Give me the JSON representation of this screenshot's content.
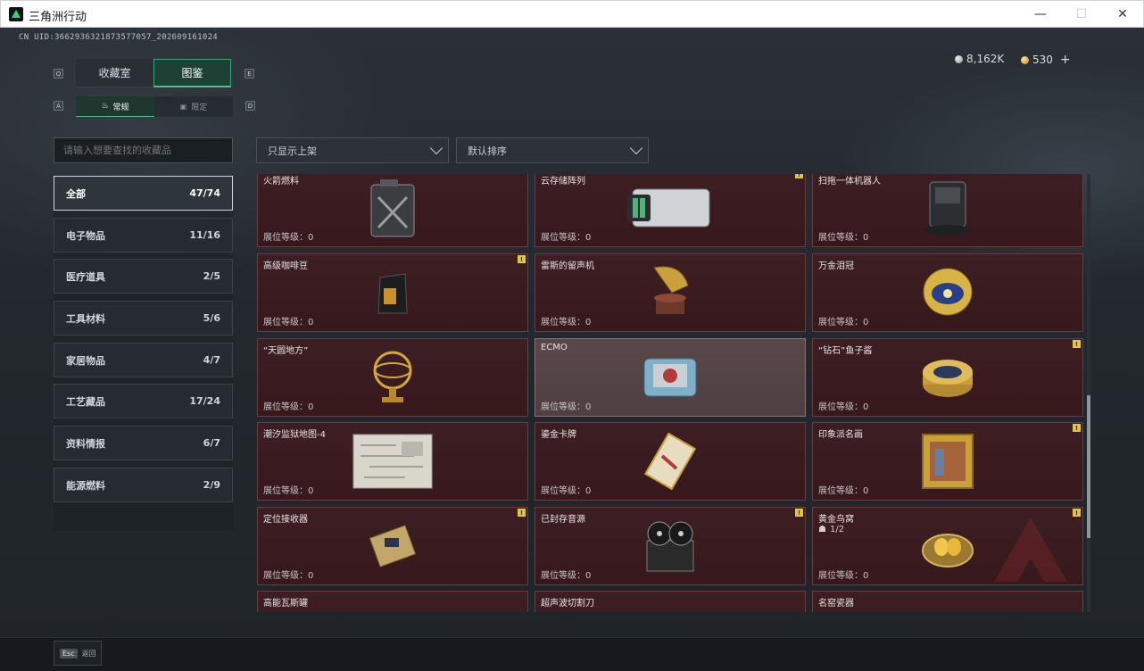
{
  "window": {
    "title": "三角洲行动",
    "min": "—",
    "max": "☐",
    "close": "✕"
  },
  "uid": "CN UID:3662936321873577057_202609161024",
  "currency": {
    "silver": "8,162K",
    "gold": "530",
    "add": "+"
  },
  "keys": {
    "q": "Q",
    "e": "E",
    "a": "A",
    "d": "D"
  },
  "tabs": [
    {
      "label": "收藏室"
    },
    {
      "label": "图鉴"
    }
  ],
  "subtabs": [
    {
      "label": "常规"
    },
    {
      "label": "限定"
    }
  ],
  "search": {
    "placeholder": "请输入想要查找的收藏品"
  },
  "filters": {
    "shelf": "只显示上架",
    "sort": "默认排序"
  },
  "categories": [
    {
      "label": "全部",
      "count": "47/74"
    },
    {
      "label": "电子物品",
      "count": "11/16"
    },
    {
      "label": "医疗道具",
      "count": "2/5"
    },
    {
      "label": "工具材料",
      "count": "5/6"
    },
    {
      "label": "家居物品",
      "count": "4/7"
    },
    {
      "label": "工艺藏品",
      "count": "17/24"
    },
    {
      "label": "资料情报",
      "count": "6/7"
    },
    {
      "label": "能源燃料",
      "count": "2/9"
    }
  ],
  "items": [
    {
      "name": "火箭燃料",
      "level": "展位等级：0",
      "badge": ""
    },
    {
      "name": "云存储阵列",
      "level": "展位等级：0",
      "badge": "!"
    },
    {
      "name": "扫拖一体机器人",
      "level": "展位等级：0",
      "badge": ""
    },
    {
      "name": "高级咖啡豆",
      "level": "展位等级：0",
      "badge": "!"
    },
    {
      "name": "雷斯的留声机",
      "level": "展位等级：0",
      "badge": ""
    },
    {
      "name": "万金泪冠",
      "level": "展位等级：0",
      "badge": ""
    },
    {
      "name": "“天圆地方”",
      "level": "展位等级：0",
      "badge": ""
    },
    {
      "name": "ECMO",
      "level": "展位等级：0",
      "badge": ""
    },
    {
      "name": "“钻石”鱼子酱",
      "level": "展位等级：0",
      "badge": "!"
    },
    {
      "name": "潮汐监狱地图-4",
      "level": "展位等级：0",
      "badge": ""
    },
    {
      "name": "鎏金卡牌",
      "level": "展位等级：0",
      "badge": ""
    },
    {
      "name": "印象派名画",
      "level": "展位等级：0",
      "badge": "!"
    },
    {
      "name": "定位接收器",
      "level": "展位等级：0",
      "badge": "!"
    },
    {
      "name": "已封存音源",
      "level": "展位等级：0",
      "badge": "!"
    },
    {
      "name": "黄金鸟窝",
      "level": "展位等级：0",
      "badge": "!",
      "extra": "1/2"
    },
    {
      "name": "高能瓦斯罐",
      "level": "",
      "badge": ""
    },
    {
      "name": "超声波切割刀",
      "level": "",
      "badge": ""
    },
    {
      "name": "名窑瓷器",
      "level": "",
      "badge": ""
    }
  ],
  "footer": {
    "key": "Esc",
    "label": "返回"
  }
}
